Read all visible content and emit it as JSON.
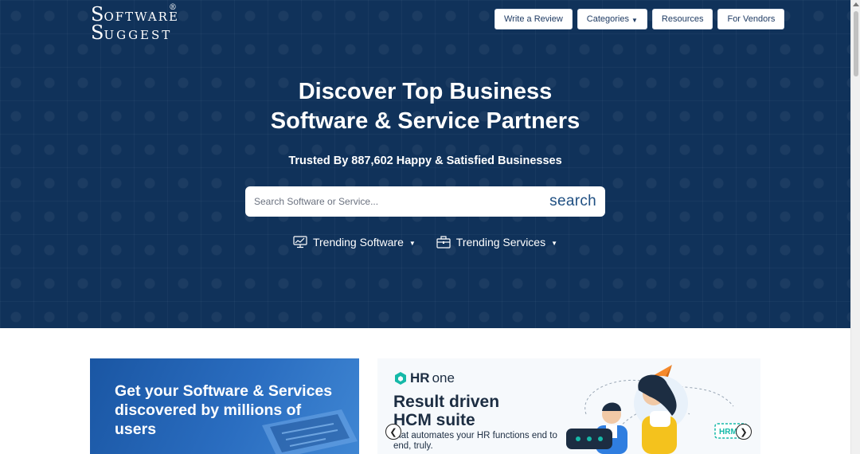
{
  "brand": {
    "logo_line1_big": "S",
    "logo_line1_rest": "OFTWARE",
    "logo_line2_big": "S",
    "logo_line2_rest": "UGGEST",
    "registered": "®"
  },
  "nav": {
    "write_review": "Write a Review",
    "categories": "Categories",
    "resources": "Resources",
    "for_vendors": "For Vendors"
  },
  "hero": {
    "title_line1": "Discover Top Business",
    "title_line2": "Software & Service Partners",
    "subtitle": "Trusted By 887,602 Happy & Satisfied Businesses",
    "search_placeholder": "Search Software or Service...",
    "search_button": "search",
    "trending_software": "Trending Software",
    "trending_services": "Trending Services"
  },
  "promo": {
    "text": "Get your Software & Services discovered by millions of users"
  },
  "banner": {
    "brand_hr": "HR",
    "brand_one": "one",
    "headline_line1": "Result driven",
    "headline_line2": "HCM suite",
    "body": "that automates your HR functions end to end, truly.",
    "tag": "HRMS"
  },
  "colors": {
    "hero_bg": "#10325a",
    "search_text": "#1f4f82",
    "promo_bg": "#1a56a3"
  },
  "icons": {
    "trending_software": "monitor-chart-icon",
    "trending_services": "briefcase-icon",
    "carousel_prev": "chevron-left-icon",
    "carousel_next": "chevron-right-icon"
  }
}
